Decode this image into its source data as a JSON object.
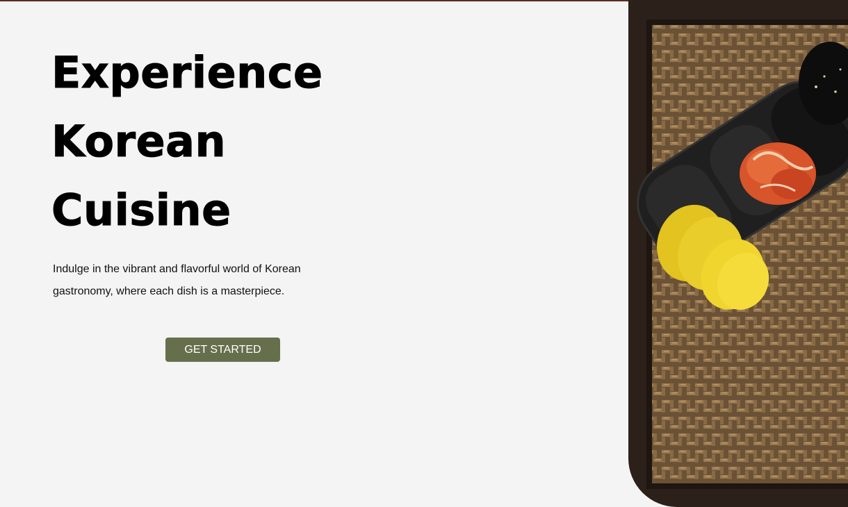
{
  "hero": {
    "title_lines": [
      "Experience",
      "Korean",
      "Cuisine"
    ],
    "description": "Indulge in the vibrant and flavorful world of Korean gastronomy, where each dish is a masterpiece.",
    "cta_label": "GET STARTED"
  },
  "colors": {
    "background": "#f4f4f4",
    "cta": "#666f4c",
    "top_border": "#5a2a20"
  },
  "image": {
    "subject": "korean-banchan-kimchi-pickled-radish-on-woven-tray"
  }
}
